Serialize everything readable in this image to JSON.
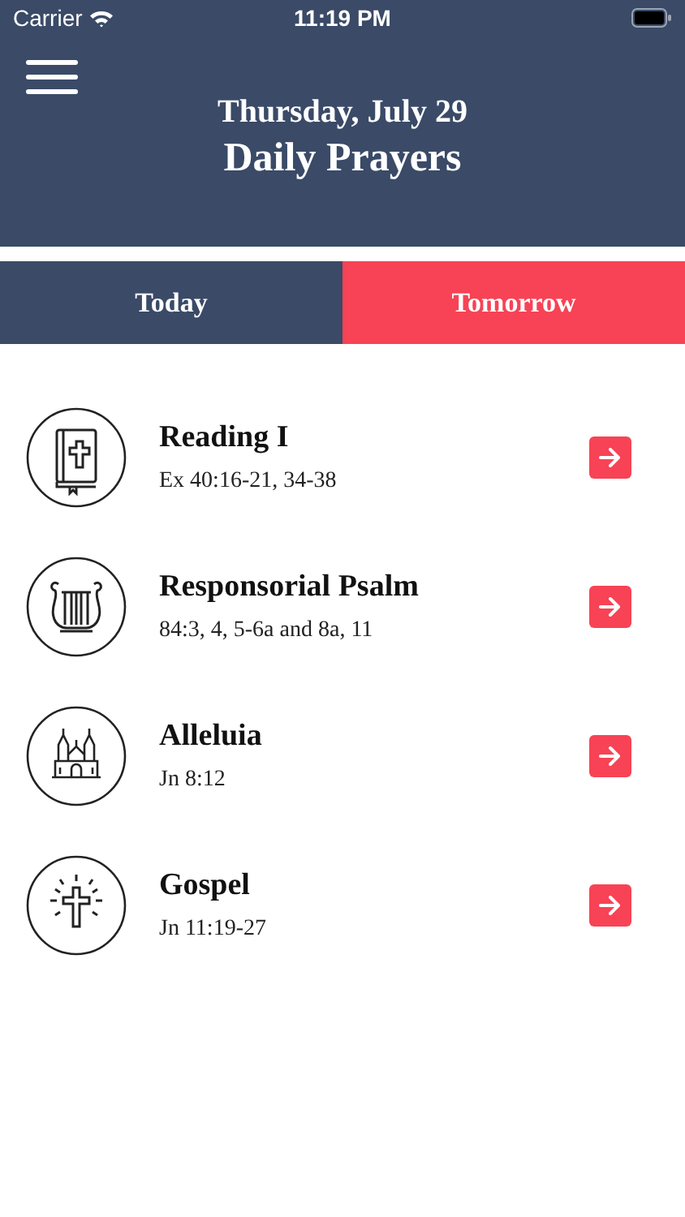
{
  "status_bar": {
    "carrier": "Carrier",
    "time": "11:19 PM"
  },
  "header": {
    "date": "Thursday, July 29",
    "title": "Daily Prayers"
  },
  "tabs": [
    {
      "label": "Today",
      "selected": false
    },
    {
      "label": "Tomorrow",
      "selected": true
    }
  ],
  "readings": [
    {
      "kind": "book",
      "title": "Reading I",
      "reference": "Ex 40:16-21, 34-38"
    },
    {
      "kind": "lyre",
      "title": "Responsorial Psalm",
      "reference": "84:3, 4, 5-6a and 8a, 11"
    },
    {
      "kind": "church",
      "title": "Alleluia",
      "reference": "Jn 8:12"
    },
    {
      "kind": "cross",
      "title": "Gospel",
      "reference": "Jn 11:19-27"
    }
  ]
}
